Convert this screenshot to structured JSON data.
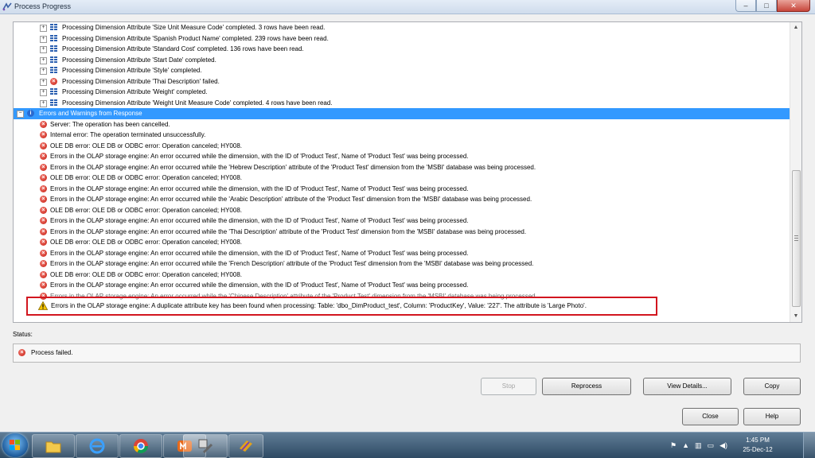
{
  "window": {
    "title": "Process Progress"
  },
  "log_rows": [
    {
      "type": "child",
      "icon": "grid",
      "text": "Processing Dimension Attribute 'Size Unit Measure Code' completed. 3 rows have been read."
    },
    {
      "type": "child",
      "icon": "grid",
      "text": "Processing Dimension Attribute 'Spanish Product Name' completed. 239 rows have been read."
    },
    {
      "type": "child",
      "icon": "grid",
      "text": "Processing Dimension Attribute 'Standard Cost' completed. 136 rows have been read."
    },
    {
      "type": "child",
      "icon": "grid",
      "text": "Processing Dimension Attribute 'Start Date' completed."
    },
    {
      "type": "child",
      "icon": "grid",
      "text": "Processing Dimension Attribute 'Style' completed."
    },
    {
      "type": "child",
      "icon": "err",
      "text": "Processing Dimension Attribute 'Thai Description' failed."
    },
    {
      "type": "child",
      "icon": "grid",
      "text": "Processing Dimension Attribute 'Weight' completed."
    },
    {
      "type": "child",
      "icon": "grid",
      "text": "Processing Dimension Attribute 'Weight Unit Measure Code' completed. 4 rows have been read."
    },
    {
      "type": "header",
      "icon": "info",
      "text": "Errors and Warnings from Response"
    },
    {
      "type": "error",
      "icon": "err",
      "text": "Server: The operation has been cancelled."
    },
    {
      "type": "error",
      "icon": "err",
      "text": "Internal error: The operation terminated unsuccessfully."
    },
    {
      "type": "error",
      "icon": "err",
      "text": "OLE DB error: OLE DB or ODBC error: Operation canceled; HY008."
    },
    {
      "type": "error",
      "icon": "err",
      "text": "Errors in the OLAP storage engine: An error occurred while the dimension, with the ID of 'Product Test', Name of 'Product Test' was being processed."
    },
    {
      "type": "error",
      "icon": "err",
      "text": "Errors in the OLAP storage engine: An error occurred while the 'Hebrew Description' attribute of the 'Product Test' dimension from the 'MSBI' database was being processed."
    },
    {
      "type": "error",
      "icon": "err",
      "text": "OLE DB error: OLE DB or ODBC error: Operation canceled; HY008."
    },
    {
      "type": "error",
      "icon": "err",
      "text": "Errors in the OLAP storage engine: An error occurred while the dimension, with the ID of 'Product Test', Name of 'Product Test' was being processed."
    },
    {
      "type": "error",
      "icon": "err",
      "text": "Errors in the OLAP storage engine: An error occurred while the 'Arabic Description' attribute of the 'Product Test' dimension from the 'MSBI' database was being processed."
    },
    {
      "type": "error",
      "icon": "err",
      "text": "OLE DB error: OLE DB or ODBC error: Operation canceled; HY008."
    },
    {
      "type": "error",
      "icon": "err",
      "text": "Errors in the OLAP storage engine: An error occurred while the dimension, with the ID of 'Product Test', Name of 'Product Test' was being processed."
    },
    {
      "type": "error",
      "icon": "err",
      "text": "Errors in the OLAP storage engine: An error occurred while the 'Thai Description' attribute of the 'Product Test' dimension from the 'MSBI' database was being processed."
    },
    {
      "type": "error",
      "icon": "err",
      "text": "OLE DB error: OLE DB or ODBC error: Operation canceled; HY008."
    },
    {
      "type": "error",
      "icon": "err",
      "text": "Errors in the OLAP storage engine: An error occurred while the dimension, with the ID of 'Product Test', Name of 'Product Test' was being processed."
    },
    {
      "type": "error",
      "icon": "err",
      "text": "Errors in the OLAP storage engine: An error occurred while the 'French Description' attribute of the 'Product Test' dimension from the 'MSBI' database was being processed."
    },
    {
      "type": "error",
      "icon": "err",
      "text": "OLE DB error: OLE DB or ODBC error: Operation canceled; HY008."
    },
    {
      "type": "error",
      "icon": "err",
      "text": "Errors in the OLAP storage engine: An error occurred while the dimension, with the ID of 'Product Test', Name of 'Product Test' was being processed."
    },
    {
      "type": "error",
      "icon": "err",
      "obscured": true,
      "text": "Errors in the OLAP storage engine: An error occurred while the 'Chinese Description' attribute of the 'Product Test' dimension from the 'MSBI' database was being processed."
    }
  ],
  "highlighted_warning": {
    "icon": "warning-icon",
    "text": "Errors in the OLAP storage engine: A duplicate attribute key has been found when processing: Table: 'dbo_DimProduct_test', Column: 'ProductKey', Value: '227'. The attribute is 'Large Photo'."
  },
  "status": {
    "label": "Status:",
    "text": "Process failed."
  },
  "buttons": {
    "stop": "Stop",
    "reprocess": "Reprocess",
    "view_details": "View Details...",
    "copy": "Copy",
    "close": "Close",
    "help": "Help"
  },
  "taskbar": {
    "time": "1:45 PM",
    "date": "25-Dec-12"
  },
  "colors": {
    "selection": "#3399ff",
    "highlight_border": "#d2161f",
    "error": "#c81e12"
  }
}
